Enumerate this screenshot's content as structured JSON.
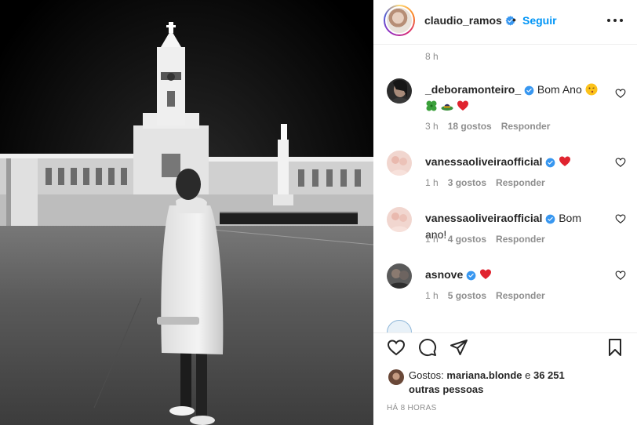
{
  "post": {
    "author": "claudio_ramos",
    "follow_label": "Seguir",
    "separator": "•",
    "time_ago": "HÁ 8 HORAS"
  },
  "caption_time": "8 h",
  "comments": [
    {
      "username": "_deboramonteiro_",
      "text": "Bom Ano",
      "emojis": [
        "face-kiss-emoji",
        "four-leaf-clover-emoji",
        "hat-emoji",
        "red-heart-emoji"
      ],
      "time": "3 h",
      "likes": "18 gostos",
      "reply": "Responder",
      "verified": true
    },
    {
      "username": "vanessaoliveiraofficial",
      "text": "",
      "emojis": [
        "red-heart-emoji"
      ],
      "time": "1 h",
      "likes": "3 gostos",
      "reply": "Responder",
      "verified": true
    },
    {
      "username": "vanessaoliveiraofficial",
      "text": "Bom ano!",
      "emojis": [],
      "time": "1 h",
      "likes": "4 gostos",
      "reply": "Responder",
      "verified": true
    },
    {
      "username": "asnove",
      "text": "",
      "emojis": [
        "red-heart-emoji"
      ],
      "time": "1 h",
      "likes": "5 gostos",
      "reply": "Responder",
      "verified": true
    }
  ],
  "likes": {
    "prefix": "Gostos:",
    "liker": "mariana.blonde",
    "joiner": "e",
    "others": "36 251 outras pessoas"
  },
  "icons": {
    "like": "heart-outline-icon",
    "comment": "comment-bubble-icon",
    "share": "paper-plane-icon",
    "save": "bookmark-icon",
    "verified": "verified-badge-icon",
    "more": "more-options-icon"
  },
  "colors": {
    "accent": "#0095f6",
    "verified": "#3897f0",
    "heart": "#ed4956",
    "secondary_text": "#8e8e8e"
  }
}
